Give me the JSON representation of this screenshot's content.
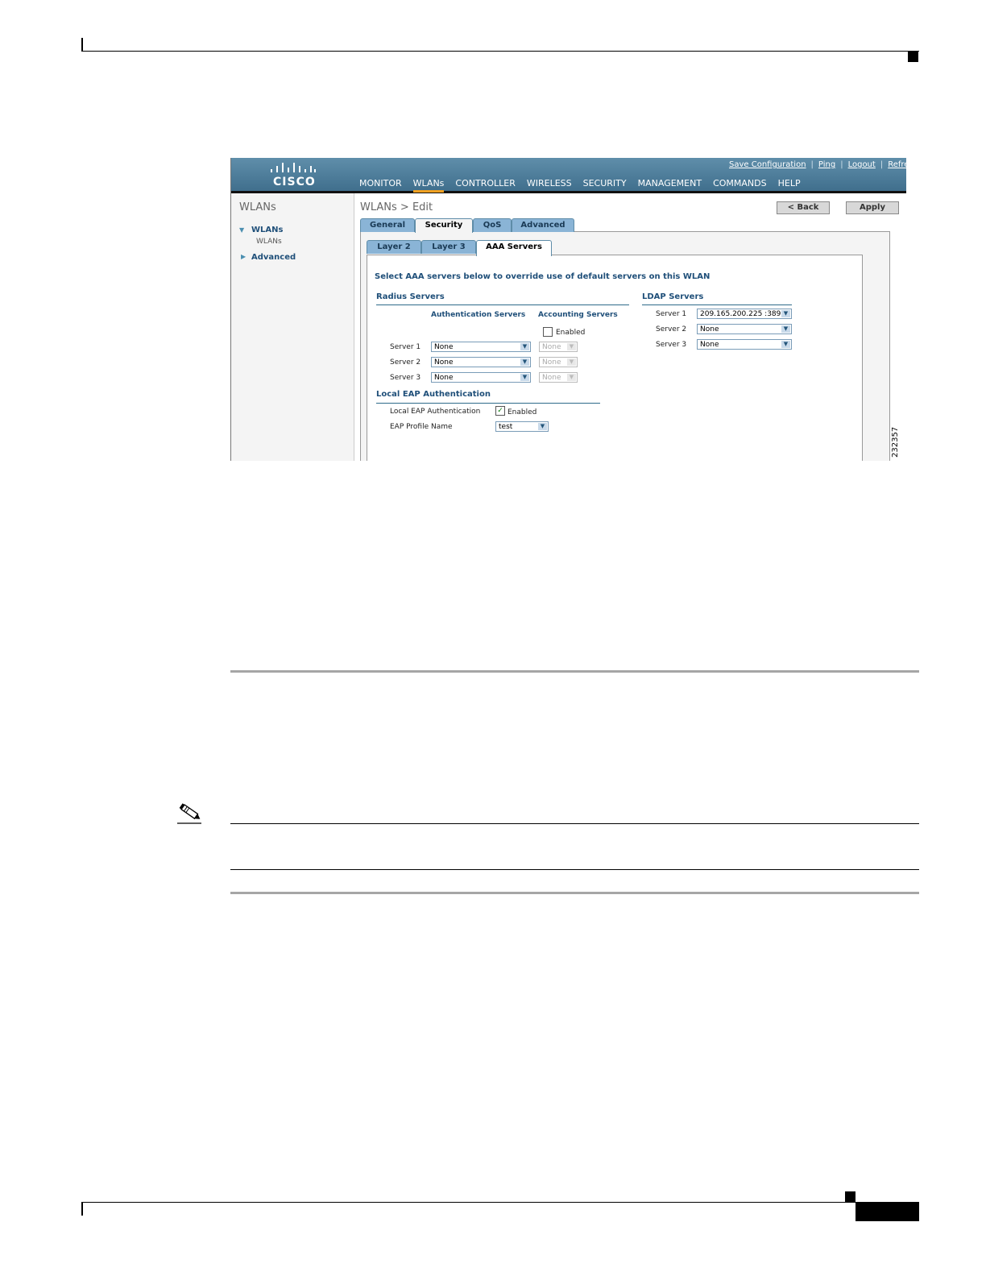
{
  "app": {
    "brand": "CISCO",
    "top_links": [
      "Save Configuration",
      "Ping",
      "Logout",
      "Refres"
    ],
    "nav": [
      "MONITOR",
      "WLANs",
      "CONTROLLER",
      "WIRELESS",
      "SECURITY",
      "MANAGEMENT",
      "COMMANDS",
      "HELP"
    ],
    "active_nav": "WLANs"
  },
  "sidebar": {
    "title": "WLANs",
    "items": [
      {
        "label": "WLANs",
        "sub": "WLANs"
      },
      {
        "label": "Advanced"
      }
    ]
  },
  "main": {
    "title": "WLANs > Edit",
    "back_label": "< Back",
    "apply_label": "Apply",
    "tabs": [
      "General",
      "Security",
      "QoS",
      "Advanced"
    ],
    "subtabs": [
      "Layer 2",
      "Layer 3",
      "AAA Servers"
    ],
    "instruction": "Select AAA servers below to override use of default servers on this WLAN",
    "radius": {
      "title": "Radius Servers",
      "auth_header": "Authentication Servers",
      "acct_header": "Accounting Servers",
      "acct_enabled_label": "Enabled",
      "rows": [
        {
          "label": "Server 1",
          "auth": "None",
          "acct": "None"
        },
        {
          "label": "Server 2",
          "auth": "None",
          "acct": "None"
        },
        {
          "label": "Server 3",
          "auth": "None",
          "acct": "None"
        }
      ]
    },
    "ldap": {
      "title": "LDAP Servers",
      "rows": [
        {
          "label": "Server 1",
          "value": "209.165.200.225 :389"
        },
        {
          "label": "Server 2",
          "value": "None"
        },
        {
          "label": "Server 3",
          "value": "None"
        }
      ]
    },
    "local_eap": {
      "title": "Local EAP Authentication",
      "auth_label": "Local EAP Authentication",
      "enabled_label": "Enabled",
      "profile_label": "EAP Profile Name",
      "profile_value": "test"
    }
  },
  "figure_id": "232357",
  "colors": {
    "banner": "#4f7e9c",
    "accent": "#f0a020",
    "link": "#1f4f79"
  }
}
